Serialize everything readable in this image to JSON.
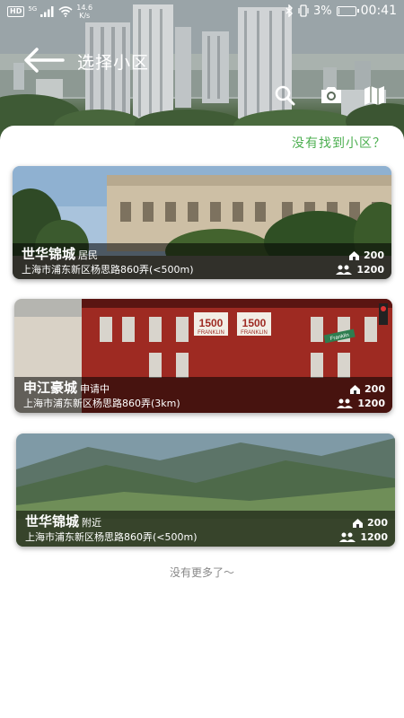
{
  "status_bar": {
    "hd": "HD",
    "signal_type": "5G",
    "net_speed_value": "14.6",
    "net_speed_unit": "K/s",
    "battery_percent": "3%",
    "battery_level": 0.03,
    "time": "00:41"
  },
  "header": {
    "title": "选择小区",
    "back_icon": "arrow-left-icon",
    "actions": [
      "search-icon",
      "camera-icon",
      "map-icon"
    ]
  },
  "not_found_link": "没有找到小区？",
  "communities": [
    {
      "name": "世华锦城",
      "tag": "居民",
      "address": "上海市浦东新区杨思路860弄(<500m)",
      "homes": "200",
      "people": "1200",
      "photo": "modern-building"
    },
    {
      "name": "申江豪城",
      "tag": "申请中",
      "address": "上海市浦东新区杨思路860弄(3km)",
      "homes": "200",
      "people": "1200",
      "photo": "red-building",
      "sign_text": "1500",
      "sign_subtext": "FRANKLIN",
      "street_sign": "Franklin"
    },
    {
      "name": "世华锦城",
      "tag": "附近",
      "address": "上海市浦东新区杨思路860弄(<500m)",
      "homes": "200",
      "people": "1200",
      "photo": "mountain-valley"
    }
  ],
  "list_end_text": "没有更多了～",
  "colors": {
    "accent_green": "#4caf50",
    "overlay": "rgba(0,0,0,0.55)"
  }
}
